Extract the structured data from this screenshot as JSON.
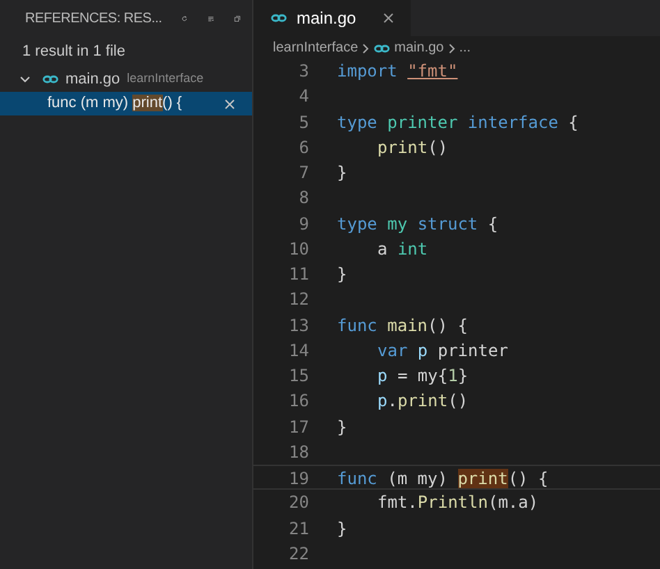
{
  "references_panel": {
    "title": "REFERENCES: RES...",
    "summary": "1 result in 1 file",
    "files": [
      {
        "name": "main.go",
        "folder": "learnInterface",
        "expanded": true,
        "results": [
          {
            "selected": true,
            "parts": [
              {
                "text": "func (m my) ",
                "highlighted": false
              },
              {
                "text": "print",
                "highlighted": true
              },
              {
                "text": "() {",
                "highlighted": false
              }
            ]
          }
        ]
      }
    ]
  },
  "editor": {
    "tabs": [
      {
        "label": "main.go",
        "selected": true
      }
    ],
    "breadcrumbs": [
      "learnInterface",
      "main.go",
      "..."
    ],
    "lines": [
      {
        "number": "3",
        "current": false,
        "indented": false,
        "tokens": [
          {
            "text": "import ",
            "kind": "keyword"
          },
          {
            "text": "\"fmt\"",
            "kind": "string"
          }
        ]
      },
      {
        "number": "4",
        "current": false,
        "indented": false
      },
      {
        "number": "5",
        "current": false,
        "indented": false,
        "tokens": [
          {
            "text": "type ",
            "kind": "keyword"
          },
          {
            "text": "printer ",
            "kind": "type"
          },
          {
            "text": "interface ",
            "kind": "keyword"
          },
          {
            "text": "{",
            "kind": "plain"
          }
        ]
      },
      {
        "number": "6",
        "current": false,
        "indented": true,
        "tokens": [
          {
            "text": "print",
            "kind": "function"
          },
          {
            "text": "()",
            "kind": "plain"
          }
        ]
      },
      {
        "number": "7",
        "current": false,
        "indented": false,
        "tokens": [
          {
            "text": "}",
            "kind": "plain"
          }
        ]
      },
      {
        "number": "8",
        "current": false,
        "indented": false
      },
      {
        "number": "9",
        "current": false,
        "indented": false,
        "tokens": [
          {
            "text": "type ",
            "kind": "keyword"
          },
          {
            "text": "my ",
            "kind": "type"
          },
          {
            "text": "struct ",
            "kind": "keyword"
          },
          {
            "text": "{",
            "kind": "plain"
          }
        ]
      },
      {
        "number": "10",
        "current": false,
        "indented": true,
        "tokens": [
          {
            "text": "a ",
            "kind": "plain"
          },
          {
            "text": "int",
            "kind": "type"
          }
        ]
      },
      {
        "number": "11",
        "current": false,
        "indented": false,
        "tokens": [
          {
            "text": "}",
            "kind": "plain"
          }
        ]
      },
      {
        "number": "12",
        "current": false,
        "indented": false
      },
      {
        "number": "13",
        "current": false,
        "indented": false,
        "tokens": [
          {
            "text": "func ",
            "kind": "keyword"
          },
          {
            "text": "main",
            "kind": "function"
          },
          {
            "text": "() {",
            "kind": "plain"
          }
        ]
      },
      {
        "number": "14",
        "current": false,
        "indented": true,
        "tokens": [
          {
            "text": "var ",
            "kind": "keyword"
          },
          {
            "text": "p ",
            "kind": "variable"
          },
          {
            "text": "printer",
            "kind": "plain"
          }
        ]
      },
      {
        "number": "15",
        "current": false,
        "indented": true,
        "tokens": [
          {
            "text": "p",
            "kind": "variable"
          },
          {
            "text": " = my{",
            "kind": "plain"
          },
          {
            "text": "1",
            "kind": "number"
          },
          {
            "text": "}",
            "kind": "plain"
          }
        ]
      },
      {
        "number": "16",
        "current": false,
        "indented": true,
        "tokens": [
          {
            "text": "p",
            "kind": "variable"
          },
          {
            "text": ".",
            "kind": "plain"
          },
          {
            "text": "print",
            "kind": "function"
          },
          {
            "text": "()",
            "kind": "plain"
          }
        ]
      },
      {
        "number": "17",
        "current": false,
        "indented": false,
        "tokens": [
          {
            "text": "}",
            "kind": "plain"
          }
        ]
      },
      {
        "number": "18",
        "current": false,
        "indented": false
      },
      {
        "number": "19",
        "current": true,
        "indented": false,
        "tokens": [
          {
            "text": "func ",
            "kind": "keyword"
          },
          {
            "text": "(m my) ",
            "kind": "plain"
          },
          {
            "text": "print",
            "kind": "match"
          },
          {
            "text": "() {",
            "kind": "plain"
          }
        ]
      },
      {
        "number": "20",
        "current": false,
        "indented": true,
        "tokens": [
          {
            "text": "fmt.",
            "kind": "plain"
          },
          {
            "text": "Println",
            "kind": "function"
          },
          {
            "text": "(m.a)",
            "kind": "plain"
          }
        ]
      },
      {
        "number": "21",
        "current": false,
        "indented": false,
        "tokens": [
          {
            "text": "}",
            "kind": "plain"
          }
        ]
      },
      {
        "number": "22",
        "current": false,
        "indented": false
      }
    ]
  }
}
